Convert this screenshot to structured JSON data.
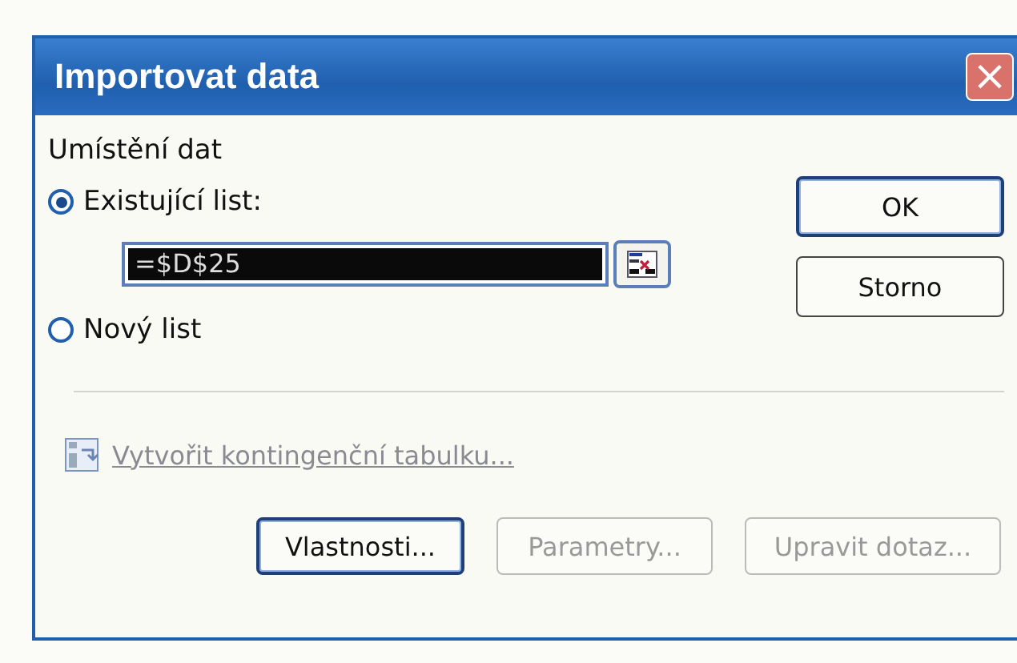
{
  "window": {
    "title": "Importovat data",
    "close": "×"
  },
  "group_label": "Umístění dat",
  "options": [
    {
      "label": "Existující list:",
      "selected": true
    },
    {
      "label": "Nový list",
      "selected": false
    }
  ],
  "range_field": {
    "value": "=$D$25",
    "highlighted": true
  },
  "pivot_link": {
    "label": "Vytvořit kontingenční tabulku...",
    "disabled": true
  },
  "side_buttons": [
    {
      "label": "OK",
      "default": true
    },
    {
      "label": "Storno",
      "default": false
    }
  ],
  "bottom_buttons": [
    {
      "label": "Vlastnosti...",
      "disabled": false,
      "default": true
    },
    {
      "label": "Parametry...",
      "disabled": true,
      "default": false
    },
    {
      "label": "Upravit dotaz...",
      "disabled": true,
      "default": false
    }
  ]
}
